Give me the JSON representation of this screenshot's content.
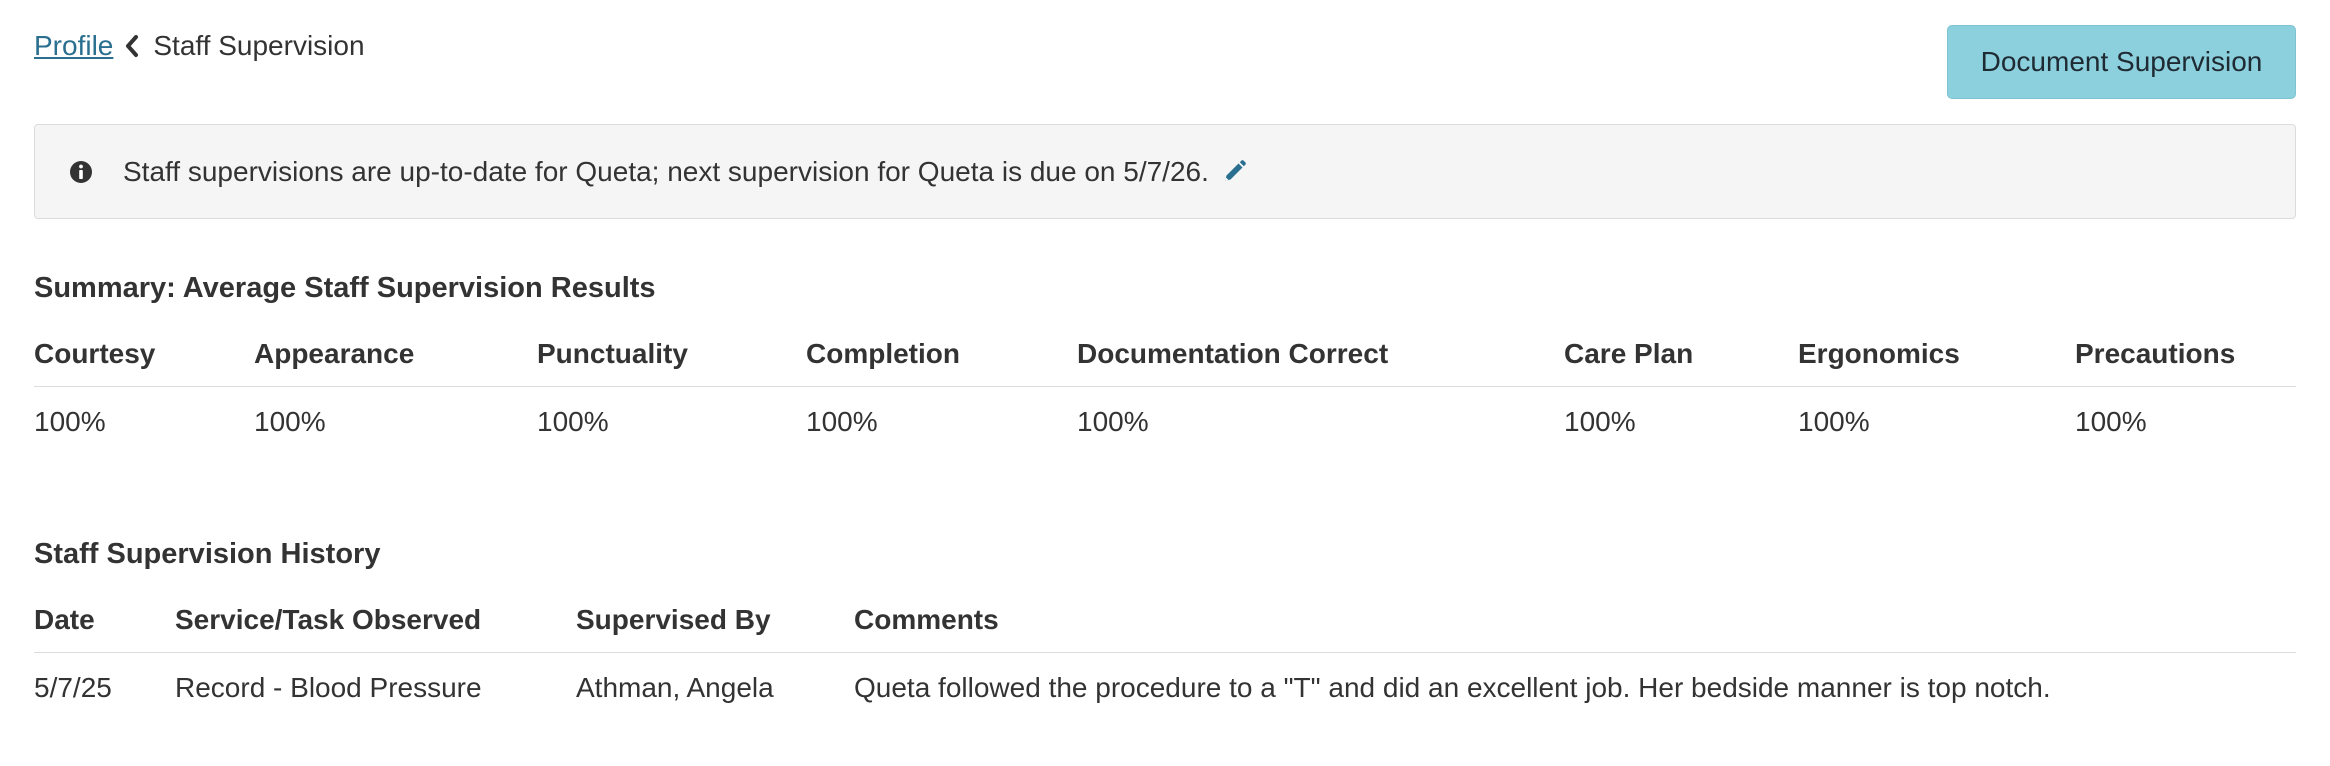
{
  "breadcrumb": {
    "parent": "Profile",
    "current": "Staff Supervision"
  },
  "actions": {
    "document_supervision": "Document Supervision"
  },
  "alert": {
    "message": "Staff supervisions are up-to-date for Queta; next supervision for Queta is due on 5/7/26."
  },
  "summary": {
    "title": "Summary: Average Staff Supervision Results",
    "columns": [
      "Courtesy",
      "Appearance",
      "Punctuality",
      "Completion",
      "Documentation Correct",
      "Care Plan",
      "Ergonomics",
      "Precautions"
    ],
    "values": [
      "100%",
      "100%",
      "100%",
      "100%",
      "100%",
      "100%",
      "100%",
      "100%"
    ]
  },
  "history": {
    "title": "Staff Supervision History",
    "columns": [
      "Date",
      "Service/Task Observed",
      "Supervised By",
      "Comments"
    ],
    "rows": [
      [
        "5/7/25",
        "Record - Blood Pressure",
        "Athman, Angela",
        "Queta followed the procedure to a \"T\" and did an excellent job. Her bedside manner is top notch."
      ]
    ]
  },
  "colors": {
    "link": "#2a6f8f",
    "button_bg": "#8ccfdd",
    "alert_bg": "#f5f5f5",
    "text": "#333333"
  },
  "icons": {
    "breadcrumb_separator": "chevron-left-icon",
    "alert": "info-circle-icon",
    "edit": "pencil-icon"
  }
}
